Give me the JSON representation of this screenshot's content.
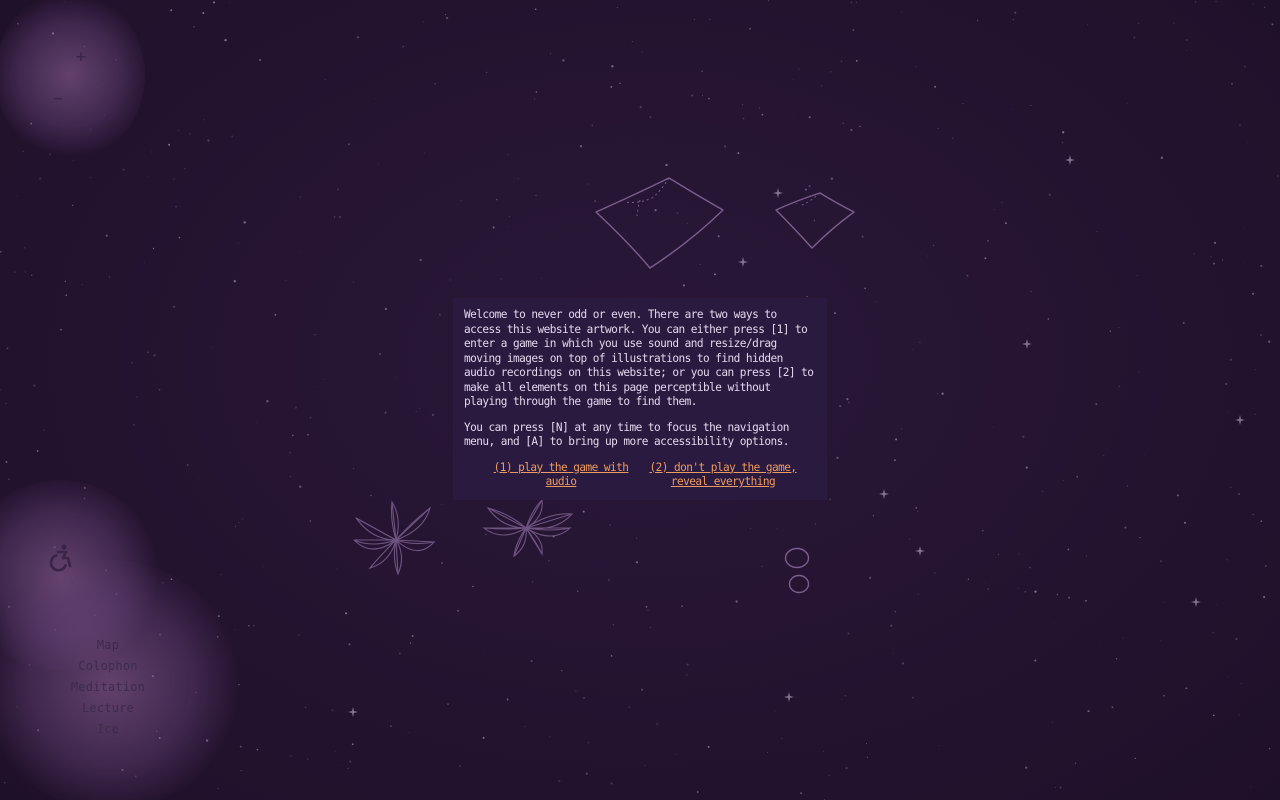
{
  "zoom": {
    "zoom_in_label": "+",
    "zoom_out_label": "−"
  },
  "accessibility": {
    "icon": "wheelchair-icon"
  },
  "nav": {
    "items": [
      {
        "label": "Map"
      },
      {
        "label": "Colophon"
      },
      {
        "label": "Meditation"
      },
      {
        "label": "Lecture"
      },
      {
        "label": "Ice"
      }
    ]
  },
  "dialog": {
    "paragraph1": "Welcome to never odd or even. There are two ways to access this website artwork. You can either press [1] to enter a game in which you use sound and resize/drag moving images on top of illustrations to find hidden audio recordings on this website; or you can press [2] to make all elements on this page perceptible without playing through the game to find them.",
    "paragraph2": "You can press [N] at any time to focus the navigation menu, and [A] to bring up more accessibility options.",
    "option1": "(1) play the game with audio",
    "option2": "(2) don't play the game, reveal everything"
  },
  "colors": {
    "background": "#251433",
    "dialog_background": "#2b1a3f",
    "dialog_text": "#e4d6ee",
    "link": "#ec9a5e",
    "nav_text": "#3d2a4c",
    "illustration_stroke": "#7a5f8c"
  }
}
